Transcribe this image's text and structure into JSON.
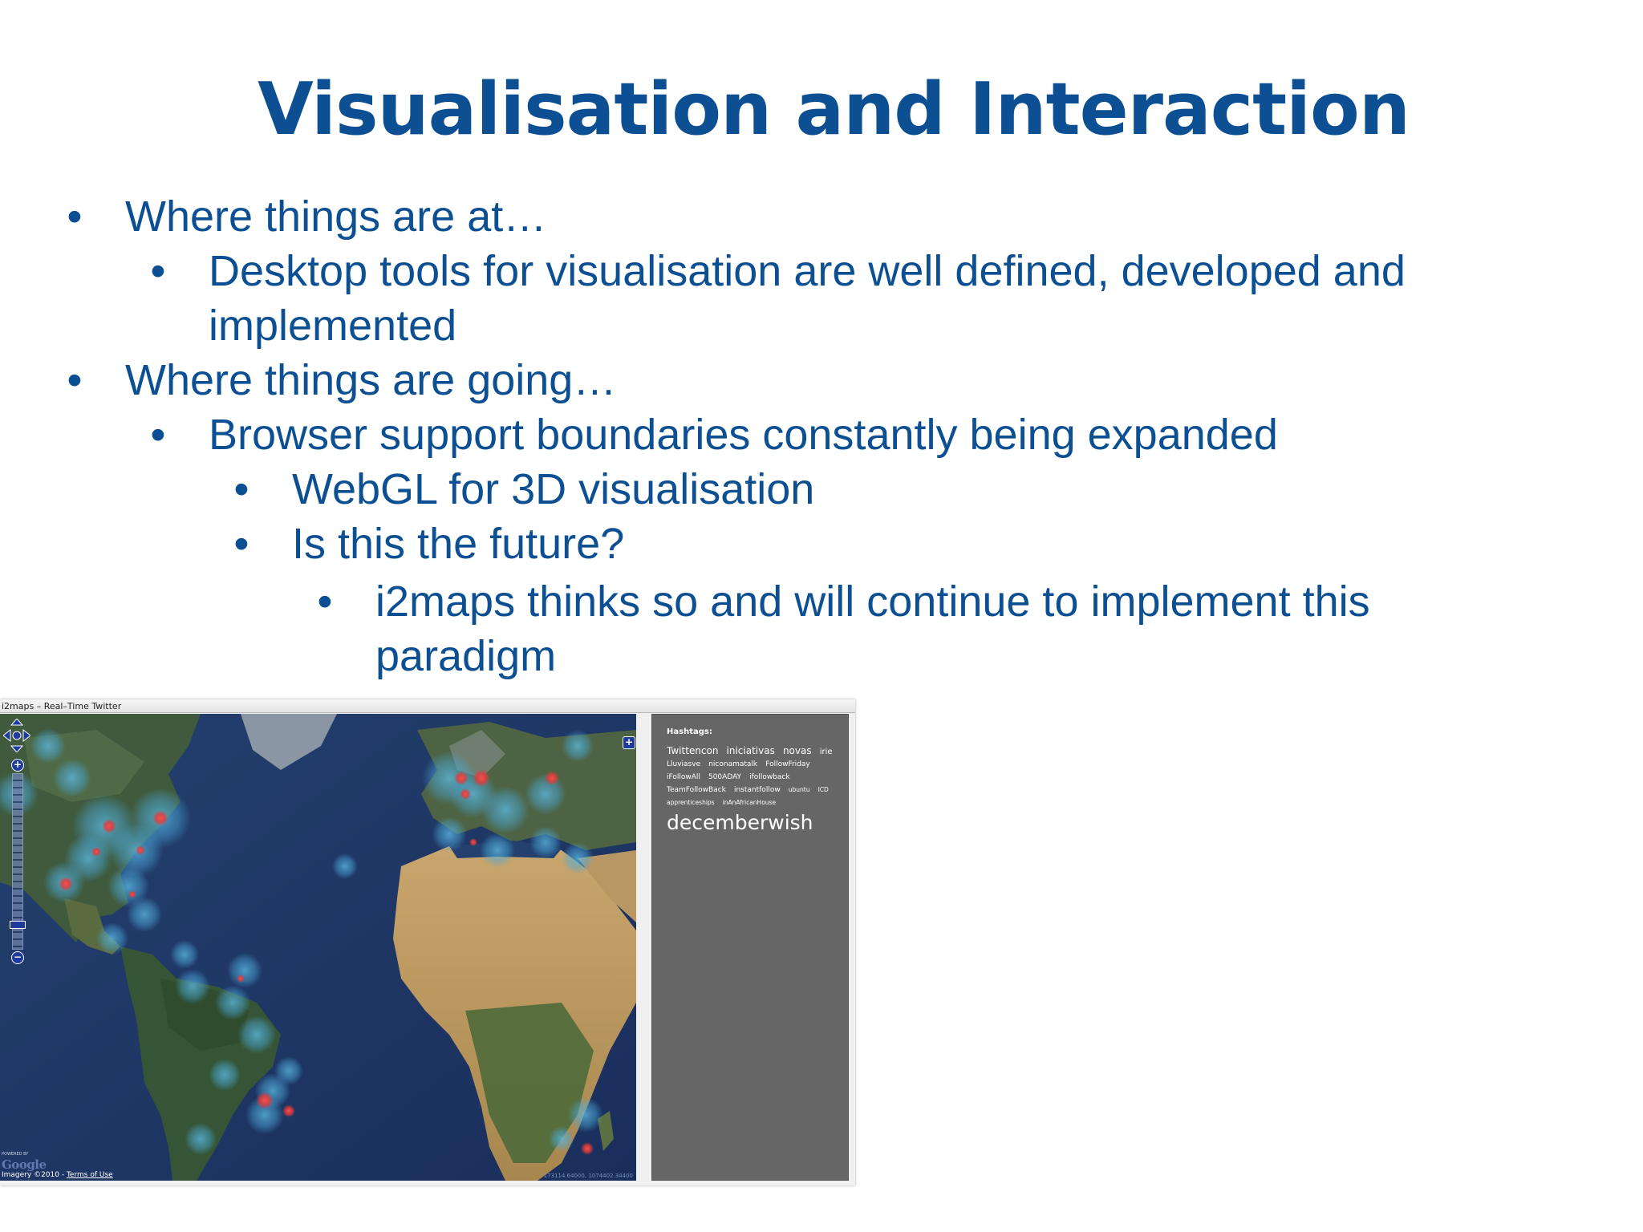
{
  "slide": {
    "title": "Visualisation and Interaction",
    "bullets": [
      {
        "marker": "•",
        "lines": [
          "Where things are at…"
        ]
      },
      {
        "marker": "•",
        "lines": [
          "Desktop tools for visualisation are well defined, developed and",
          "implemented"
        ]
      },
      {
        "marker": "•",
        "lines": [
          "Where things are going…"
        ]
      },
      {
        "marker": "•",
        "lines": [
          "Browser support boundaries constantly being expanded"
        ]
      },
      {
        "marker": "•",
        "lines": [
          "WebGL for 3D visualisation"
        ]
      },
      {
        "marker": "•",
        "lines": [
          "Is this the future?"
        ]
      },
      {
        "marker": "•",
        "lines": [
          "i2maps thinks so and will continue to implement this",
          "paradigm"
        ]
      }
    ]
  },
  "screenshot": {
    "window_title": "i2maps – Real–Time Twitter",
    "map": {
      "zoom_in_label": "+",
      "zoom_out_label": "−",
      "layer_switcher_label": "+",
      "powered_by": "POWERED BY",
      "google_logo": "Google",
      "imagery_credit": "Imagery ©2010 - ",
      "terms_link": "Terms of Use",
      "coordinates": "-173114.64000, 1074402.34400"
    },
    "sidebar": {
      "heading": "Hashtags:",
      "tags": [
        {
          "text": "Twittencon",
          "size": "l"
        },
        {
          "text": "iniciativas",
          "size": "l"
        },
        {
          "text": "novas",
          "size": "l"
        },
        {
          "text": "irie",
          "size": "m"
        },
        {
          "text": "Lluviasve",
          "size": "s"
        },
        {
          "text": "niconamatalk",
          "size": "s"
        },
        {
          "text": "FollowFriday",
          "size": "s"
        },
        {
          "text": "iFollowAll",
          "size": "s"
        },
        {
          "text": "500ADAY",
          "size": "s"
        },
        {
          "text": "ifollowback",
          "size": "s"
        },
        {
          "text": "TeamFollowBack",
          "size": "s"
        },
        {
          "text": "instantfollow",
          "size": "s"
        },
        {
          "text": "ubuntu",
          "size": "xs"
        },
        {
          "text": "ICD",
          "size": "xs"
        },
        {
          "text": "apprenticeships",
          "size": "xs"
        },
        {
          "text": "inAnAfricanHouse",
          "size": "xs"
        },
        {
          "text": "decemberwish",
          "size": "big"
        }
      ]
    },
    "heat_color": "#e23b3b",
    "glow_color": "#4aa8d8",
    "ocean_color": "#1f3768"
  }
}
